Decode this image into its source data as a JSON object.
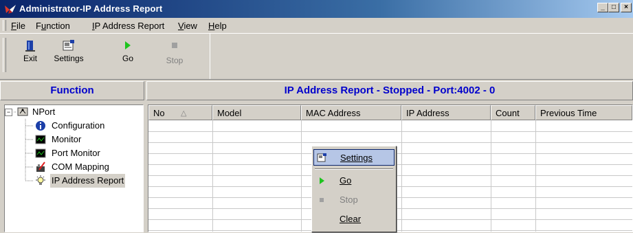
{
  "window": {
    "title": "Administrator-IP Address Report",
    "buttons": {
      "minimize": "_",
      "maximize": "□",
      "close": "×"
    }
  },
  "menubar": {
    "items": [
      {
        "label": "File",
        "mnemonic": "F"
      },
      {
        "label": "Function",
        "mnemonic": "u"
      },
      {
        "label": "IP Address Report",
        "mnemonic": "I"
      },
      {
        "label": "View",
        "mnemonic": "V"
      },
      {
        "label": "Help",
        "mnemonic": "H"
      }
    ]
  },
  "toolbar": {
    "exit_label": "Exit",
    "settings_label": "Settings",
    "go_label": "Go",
    "stop_label": "Stop"
  },
  "left_pane": {
    "header": "Function",
    "tree": {
      "root": {
        "label": "NPort",
        "expander": "−",
        "icon": "network-icon"
      },
      "children": [
        {
          "label": "Configuration",
          "icon": "info-icon"
        },
        {
          "label": "Monitor",
          "icon": "monitor-icon"
        },
        {
          "label": "Port Monitor",
          "icon": "monitor-icon"
        },
        {
          "label": "COM Mapping",
          "icon": "com-mapping-icon"
        },
        {
          "label": "IP Address Report",
          "icon": "lightbulb-icon",
          "selected": true
        }
      ]
    }
  },
  "right_pane": {
    "header": "IP Address Report - Stopped - Port:4002 - 0",
    "columns": [
      "No",
      "Model",
      "MAC Address",
      "IP Address",
      "Count",
      "Previous Time"
    ],
    "sort_indicator": "△",
    "rows": []
  },
  "context_menu": {
    "items": [
      {
        "label": "Settings",
        "icon": "settings-icon",
        "highlighted": true,
        "enabled": true
      },
      {
        "label": "Go",
        "icon": "play-icon",
        "enabled": true
      },
      {
        "label": "Stop",
        "icon": "stop-icon",
        "enabled": false
      },
      {
        "label": "Clear",
        "icon": "",
        "enabled": true
      }
    ]
  },
  "colors": {
    "titlebar_start": "#0a246a",
    "titlebar_end": "#a6caf0",
    "header_text": "#0000cc",
    "face": "#d4d0c8",
    "highlight": "#b6c6e6"
  }
}
